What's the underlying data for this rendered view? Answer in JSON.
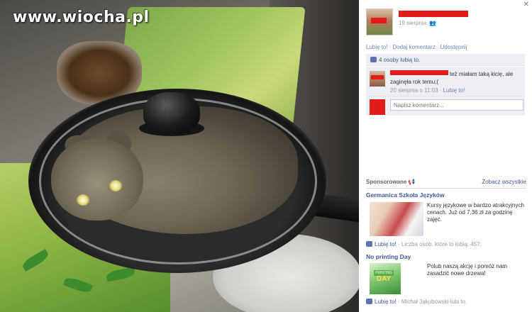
{
  "watermark": "www.wiocha.pl",
  "post": {
    "date": "19 sierpnia",
    "actions": {
      "like": "Lubię to!",
      "comment": "Dodaj komentarz",
      "share": "Udostępnij"
    },
    "likes_summary": "4 osoby lubią to.",
    "comment": {
      "text": "też miałam taką kicię, ale zaginęła rok temu;(",
      "date": "20 sierpnia o 11:03",
      "like": "Lubię to!"
    },
    "write_placeholder": "Napisz komentarz..."
  },
  "sponsored": {
    "title": "Sponsorowane",
    "see_all": "Zobacz wszystkie",
    "ads": [
      {
        "title": "Germanica Szkoła Języków",
        "text": "Kursy językowe w bardzo atrakcyjnych cenach. Już od 7,36 zł za godzinę zajęć.",
        "like": "Lubię to!",
        "like_meta": "Liczba osób, które to lubią: 457."
      },
      {
        "title": "No printing Day",
        "text": "Polub naszą akcję i pomóż nam zasadzić nowe drzewa!",
        "image_tag": "PRINTING",
        "image_text": "DAY",
        "like": "Lubię to!",
        "like_meta": "Michał Jakubowski lubi to."
      }
    ]
  },
  "colors": {
    "link": "#3b5998",
    "redaction": "#e31b1b",
    "panel_bg": "#edeff4"
  }
}
